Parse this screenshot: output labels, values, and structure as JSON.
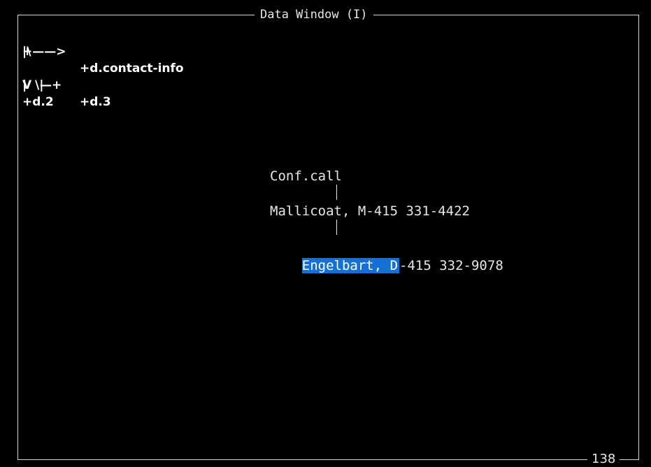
{
  "window": {
    "title": "Data Window (I)",
    "page_number": "138"
  },
  "nav_map": {
    "arrow_row": "+——> ",
    "link_contact_info": "+d.contact-info",
    "row2": "|\\",
    "row3_glyph": "|  \\|",
    "link_d3": "+d.3",
    "row4": "V  —+",
    "link_d2": "+d.2"
  },
  "tree": {
    "node1": "Conf.call",
    "node2": "Mallicoat, M-415 331-4422",
    "node3_selected": "Engelbart, D",
    "node3_rest": "-415 332-9078"
  },
  "colors": {
    "background": "#000000",
    "text": "#e6e6e6",
    "selection": "#1570d6",
    "frame": "#d8d8d8"
  }
}
